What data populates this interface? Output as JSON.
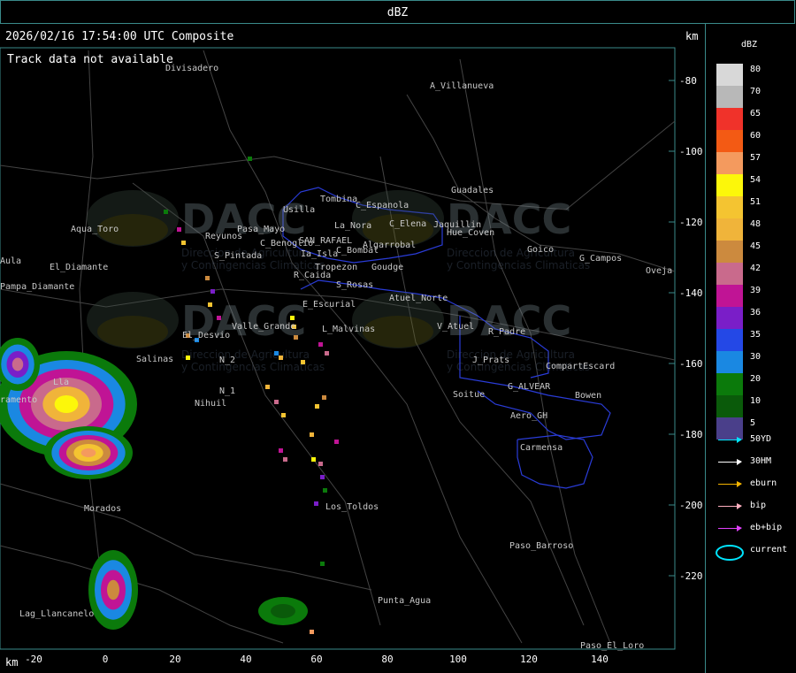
{
  "header": {
    "title": "dBZ",
    "timestamp": "2026/02/16 17:54:00 UTC Composite",
    "track_msg": "Track data not available",
    "km_unit": "km"
  },
  "legend": {
    "title": "dBZ",
    "scale": [
      {
        "label": "80",
        "color": "#d8d8d8"
      },
      {
        "label": "70",
        "color": "#b8b8b8"
      },
      {
        "label": "65",
        "color": "#f0322a"
      },
      {
        "label": "60",
        "color": "#f35a14"
      },
      {
        "label": "57",
        "color": "#f49a5e"
      },
      {
        "label": "54",
        "color": "#fcf70a"
      },
      {
        "label": "51",
        "color": "#f4c431"
      },
      {
        "label": "48",
        "color": "#f0b43a"
      },
      {
        "label": "45",
        "color": "#cc8a3e"
      },
      {
        "label": "42",
        "color": "#c96a8c"
      },
      {
        "label": "39",
        "color": "#c01495"
      },
      {
        "label": "36",
        "color": "#7a1ec8"
      },
      {
        "label": "35",
        "color": "#2448e6"
      },
      {
        "label": "30",
        "color": "#1a88e2"
      },
      {
        "label": "20",
        "color": "#0b7a0b"
      },
      {
        "label": "10",
        "color": "#0a5a0a"
      },
      {
        "label": "5",
        "color": "#4a3f8a"
      }
    ],
    "tracks": [
      {
        "label": "50YD",
        "color": "#00e5ff"
      },
      {
        "label": "30HM",
        "color": "#ffffff"
      },
      {
        "label": "eburn",
        "color": "#f4b400"
      },
      {
        "label": "bip",
        "color": "#ffb0c0"
      },
      {
        "label": "eb+bip",
        "color": "#e040fb"
      },
      {
        "label": "current",
        "color": "#00e5ff"
      }
    ]
  },
  "axes": {
    "x_ticks": [
      "-20",
      "0",
      "20",
      "40",
      "60",
      "80",
      "100",
      "120",
      "140"
    ],
    "y_ticks": [
      "-80",
      "-100",
      "-120",
      "-140",
      "-160",
      "-180",
      "-200",
      "-220"
    ]
  },
  "places": [
    "Divisadero",
    "A_Villanueva",
    "Guadales",
    "Tombina",
    "Usilla",
    "C_Espanola",
    "La_Nora",
    "C_Elena",
    "Jaquillin",
    "Hue_Coven",
    "SAN_RAFAEL",
    "C_Benoglio",
    "Aqua_Toro",
    "Reyunos",
    "Pasa_Mayo",
    "Algarrobal",
    "C_Bombal",
    "Goico",
    "G_Campos",
    "Oveja",
    "Aula",
    "Pampa_Diamante",
    "El_Diamante",
    "S_Pintada",
    "Ia_Isla",
    "Tropezon",
    "Goudge",
    "R_Caida",
    "S_Rosas",
    "Atuel_Norte",
    "E_Escurial",
    "Valle_Grande",
    "L_Malvinas",
    "V_Atuel",
    "R_Padre",
    "El_Desvio",
    "Salinas",
    "N_2",
    "N_1",
    "Nihuil",
    "J_Prats",
    "CompartEscard",
    "G_ALVEAR",
    "Soitue",
    "Bowen",
    "Aero_GH",
    "Carmensa",
    "Morados",
    "Los_Toldos",
    "Paso_Barroso",
    "Punta_Agua",
    "Lag_Llancanelo",
    "Paso_El_Loro",
    "ramento",
    "Lla"
  ],
  "watermark": {
    "brand": "DACC",
    "line1": "Direccion de Agricultura",
    "line2": "y Contingencias Climaticas"
  }
}
